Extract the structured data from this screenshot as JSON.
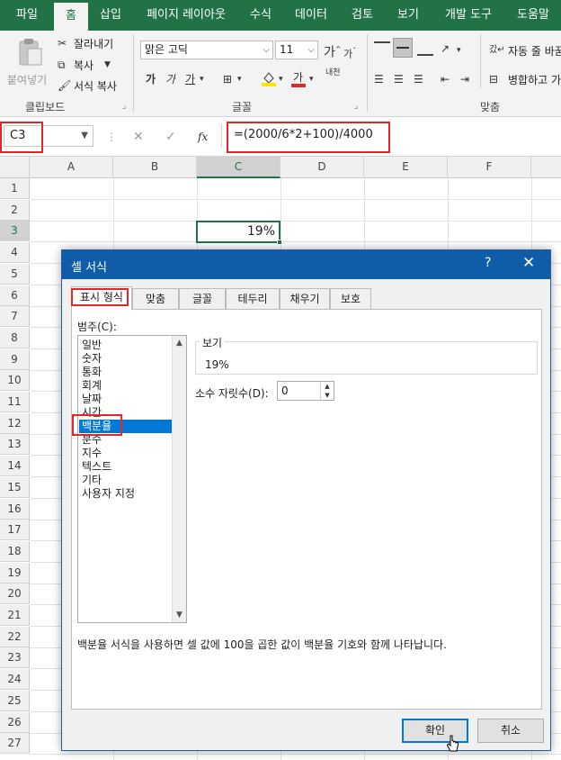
{
  "ribbon_tabs": [
    "파일",
    "홈",
    "삽입",
    "페이지 레이아웃",
    "수식",
    "데이터",
    "검토",
    "보기",
    "개발 도구",
    "도움말"
  ],
  "active_tab": "홈",
  "clipboard": {
    "paste": "붙여넣기",
    "cut": "잘라내기",
    "copy": "복사",
    "format_painter": "서식 복사",
    "group_label": "클립보드"
  },
  "font": {
    "name": "맑은 고딕",
    "size": "11",
    "group_label": "글꼴",
    "bold": "가",
    "italic": "가",
    "underline": "가",
    "grow": "가",
    "shrink": "가",
    "font_color": "가",
    "phonetic": "내천"
  },
  "alignment": {
    "wrap_text": "자동 줄 바꿈",
    "merge_center": "병합하고 가",
    "group_label": "맞춤"
  },
  "formula_bar": {
    "name_box": "C3",
    "cancel": "✕",
    "enter": "✓",
    "fx": "fx",
    "formula": "=(2000/6*2+100)/4000"
  },
  "sheet": {
    "columns": [
      "A",
      "B",
      "C",
      "D",
      "E",
      "F"
    ],
    "selected_column": "C",
    "rows": [
      "1",
      "2",
      "3",
      "4",
      "5",
      "6",
      "7",
      "8",
      "9",
      "10",
      "11",
      "12",
      "13",
      "14",
      "15",
      "16",
      "17",
      "18",
      "19",
      "20",
      "21",
      "22",
      "23",
      "24",
      "25",
      "26",
      "27"
    ],
    "selected_row": "3",
    "cell_c3_value": "19%"
  },
  "dialog": {
    "title": "셀 서식",
    "help": "?",
    "close": "✕",
    "tabs": [
      "표시 형식",
      "맞춤",
      "글꼴",
      "테두리",
      "채우기",
      "보호"
    ],
    "active_tab": "표시 형식",
    "category_label": "범주(C):",
    "categories": [
      "일반",
      "숫자",
      "통화",
      "회계",
      "날짜",
      "시간",
      "백분율",
      "분수",
      "지수",
      "텍스트",
      "기타",
      "사용자 지정"
    ],
    "selected_category": "백분율",
    "sample_label": "보기",
    "sample_value": "19%",
    "decimal_label": "소수 자릿수(D):",
    "decimal_value": "0",
    "description": "백분율 서식을 사용하면 셀 값에 100을 곱한 값이 백분율 기호와 함께 나타납니다.",
    "ok": "확인",
    "cancel": "취소"
  },
  "colors": {
    "excel_green": "#217346",
    "dialog_title": "#0f5da8",
    "selection_blue": "#0078d7",
    "highlight_red": "#e0282a"
  }
}
